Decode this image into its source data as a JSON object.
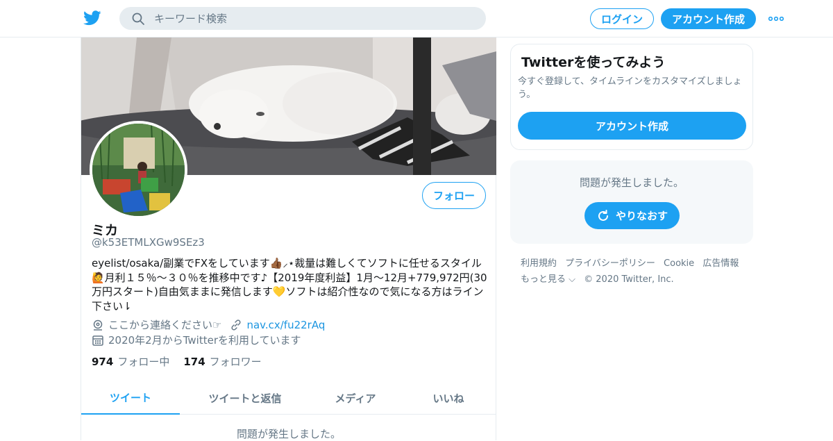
{
  "colors": {
    "accent": "#1da1f2",
    "muted": "#657786",
    "link": "#1b95e0",
    "border": "#e6ecf0"
  },
  "header": {
    "logo_icon": "twitter-bird-icon",
    "search_placeholder": "キーワード検索",
    "login_label": "ログイン",
    "signup_label": "アカウント作成",
    "more_icon": "more-dots-icon"
  },
  "profile": {
    "follow_label": "フォロー",
    "name": "ミカ",
    "handle": "@k53ETMLXGw9SEz3",
    "bio": "eyelist/osaka/副業でFXをしています👍🏾⸝⋆裁量は難しくてソフトに任せるスタイル🙋月利１５％〜３０％を推移中です♪【2019年度利益】1月〜12月+779,972円(30万円スタート)自由気ままに発信します💛ソフトは紹介性なので気になる方はライン下さい⇂",
    "location": "ここから連絡ください☞",
    "url": "nav.cx/fu22rAq",
    "joined": "2020年2月からTwitterを利用しています",
    "following_count": "974",
    "following_label": "フォロー中",
    "followers_count": "174",
    "followers_label": "フォロワー",
    "tabs": [
      "ツイート",
      "ツイートと返信",
      "メディア",
      "いいね"
    ],
    "bottom_message": "問題が発生しました。"
  },
  "sidebar": {
    "card_title": "Twitterを使ってみよう",
    "card_text": "今すぐ登録して、タイムラインをカスタマイズしましょう。",
    "card_button": "アカウント作成",
    "error_text": "問題が発生しました。",
    "retry_label": "やりなおす",
    "footer_links": [
      "利用規約",
      "プライバシーポリシー",
      "Cookie",
      "広告情報",
      "もっと見る ⌵"
    ],
    "copyright": "© 2020 Twitter, Inc."
  }
}
